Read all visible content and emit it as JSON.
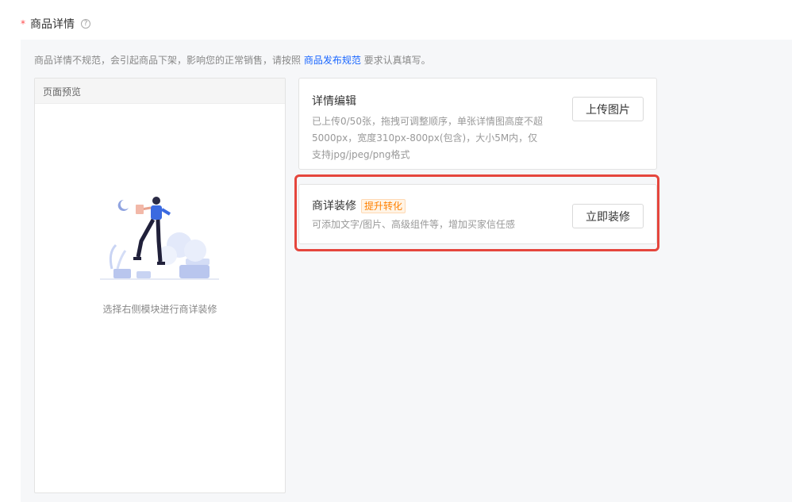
{
  "field": {
    "required": "*",
    "title": "商品详情",
    "help_icon": "?"
  },
  "notice": {
    "prefix": "商品详情不规范，会引起商品下架，影响您的正常销售，请按照 ",
    "link": "商品发布规范",
    "suffix": " 要求认真填写。"
  },
  "preview": {
    "header": "页面预览",
    "empty_text": "选择右侧模块进行商详装修"
  },
  "detail_edit": {
    "title": "详情编辑",
    "desc": "已上传0/50张，拖拽可调整顺序，单张详情图高度不超5000px，宽度310px-800px(包含)，大小5M内，仅支持jpg/jpeg/png格式",
    "button": "上传图片"
  },
  "decorate": {
    "title": "商详装修",
    "badge": "提升转化",
    "desc": "可添加文字/图片、高级组件等，增加买家信任感",
    "button": "立即装修"
  },
  "colors": {
    "link": "#1966ff",
    "highlight": "#e5463d",
    "badge": "#ff8000"
  }
}
